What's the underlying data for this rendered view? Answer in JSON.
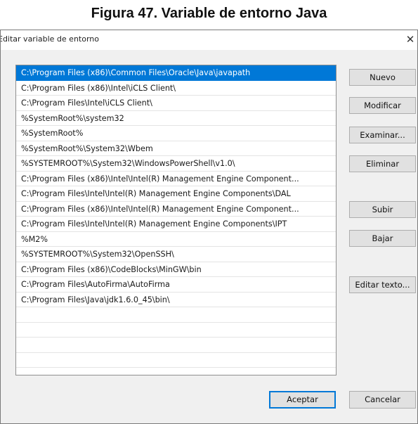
{
  "caption": "Figura 47. Variable de entorno Java",
  "dialog": {
    "title": "Editar variable de entorno",
    "close_glyph": "✕"
  },
  "paths": [
    "C:\\Program Files (x86)\\Common Files\\Oracle\\Java\\javapath",
    "C:\\Program Files (x86)\\Intel\\iCLS Client\\",
    "C:\\Program Files\\Intel\\iCLS Client\\",
    "%SystemRoot%\\system32",
    "%SystemRoot%",
    "%SystemRoot%\\System32\\Wbem",
    "%SYSTEMROOT%\\System32\\WindowsPowerShell\\v1.0\\",
    "C:\\Program Files (x86)\\Intel\\Intel(R) Management Engine Component...",
    "C:\\Program Files\\Intel\\Intel(R) Management Engine Components\\DAL",
    "C:\\Program Files (x86)\\Intel\\Intel(R) Management Engine Component...",
    "C:\\Program Files\\Intel\\Intel(R) Management Engine Components\\IPT",
    "%M2%",
    "%SYSTEMROOT%\\System32\\OpenSSH\\",
    "C:\\Program Files (x86)\\CodeBlocks\\MinGW\\bin",
    "C:\\Program Files\\AutoFirma\\AutoFirma",
    "C:\\Program Files\\Java\\jdk1.6.0_45\\bin\\",
    "",
    "",
    "",
    "",
    ""
  ],
  "selected_index": 0,
  "buttons": {
    "nuevo": "Nuevo",
    "modificar": "Modificar",
    "examinar": "Examinar...",
    "eliminar": "Eliminar",
    "subir": "Subir",
    "bajar": "Bajar",
    "editar_texto": "Editar texto...",
    "aceptar": "Aceptar",
    "cancelar": "Cancelar"
  },
  "colors": {
    "selection": "#0078d7",
    "button_face": "#e1e1e1",
    "dialog_bg": "#f0f0f0"
  }
}
